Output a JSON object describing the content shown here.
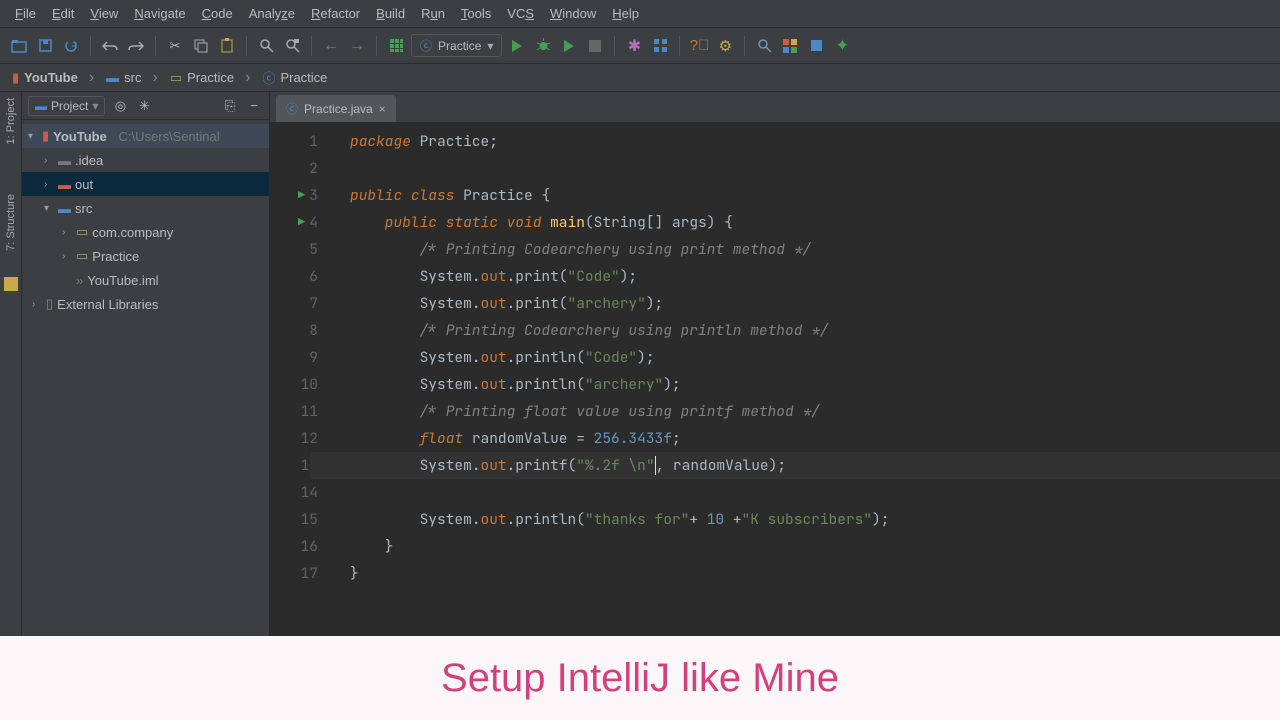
{
  "menu": [
    "File",
    "Edit",
    "View",
    "Navigate",
    "Code",
    "Analyze",
    "Refactor",
    "Build",
    "Run",
    "Tools",
    "VCS",
    "Window",
    "Help"
  ],
  "runConfig": {
    "label": "Practice"
  },
  "breadcrumbs": [
    {
      "icon": "project",
      "label": "YouTube"
    },
    {
      "icon": "folder-blue",
      "label": "src"
    },
    {
      "icon": "package",
      "label": "Practice"
    },
    {
      "icon": "class",
      "label": "Practice"
    }
  ],
  "leftrail": {
    "project": "1: Project",
    "structure": "7: Structure"
  },
  "sidebar": {
    "selector": "Project",
    "root": {
      "name": "YouTube",
      "path": "C:\\Users\\Sentinal"
    },
    "tree": [
      {
        "lvl": 1,
        "arrow": ">",
        "icon": "folder-grey",
        "label": ".idea"
      },
      {
        "lvl": 1,
        "arrow": ">",
        "icon": "folder-red",
        "label": "out",
        "hl": true
      },
      {
        "lvl": 1,
        "arrow": "v",
        "icon": "folder-blue",
        "label": "src"
      },
      {
        "lvl": 2,
        "arrow": ">",
        "icon": "package",
        "label": "com.company"
      },
      {
        "lvl": 2,
        "arrow": ">",
        "icon": "package",
        "label": "Practice"
      },
      {
        "lvl": 2,
        "arrow": "",
        "icon": "iml",
        "label": "YouTube.iml"
      },
      {
        "lvl": 0,
        "arrow": ">",
        "icon": "lib",
        "label": "External Libraries"
      }
    ]
  },
  "tab": {
    "label": "Practice.java"
  },
  "code": {
    "lines": [
      1,
      2,
      3,
      4,
      5,
      6,
      7,
      8,
      9,
      10,
      11,
      12,
      13,
      14,
      15,
      16,
      17
    ],
    "l1": {
      "a": "package ",
      "b": "Practice;"
    },
    "l3": {
      "a": "public class ",
      "b": "Practice {"
    },
    "l4": {
      "a": "    public static void ",
      "b": "main",
      "c": "(String[] args) {"
    },
    "l5": "        /* Printing Codearchery using print method */",
    "l6": {
      "a": "        System.",
      "b": "out",
      "c": ".print(",
      "d": "\"Code\"",
      "e": ");"
    },
    "l7": {
      "a": "        System.",
      "b": "out",
      "c": ".print(",
      "d": "\"archery\"",
      "e": ");"
    },
    "l8": "        /* Printing Codearchery using println method */",
    "l9": {
      "a": "        System.",
      "b": "out",
      "c": ".println(",
      "d": "\"Code\"",
      "e": ");"
    },
    "l10": {
      "a": "        System.",
      "b": "out",
      "c": ".println(",
      "d": "\"archery\"",
      "e": ");"
    },
    "l11": "        /* Printing float value using printf method */",
    "l12": {
      "a": "        float ",
      "b": "randomValue = ",
      "c": "256.3433f",
      "d": ";"
    },
    "l13": {
      "a": "        System.",
      "b": "out",
      "c": ".printf(",
      "d": "\"%.2f \\n\"",
      "e": ", randomValue);"
    },
    "l15": {
      "a": "        System.",
      "b": "out",
      "c": ".println(",
      "d": "\"thanks for\"",
      "e": "+ ",
      "f": "10 ",
      "g": "+",
      "h": "\"K subscribers\"",
      "i": ");"
    },
    "l16": "    }",
    "l17": "}"
  },
  "banner": "Setup IntelliJ like Mine"
}
